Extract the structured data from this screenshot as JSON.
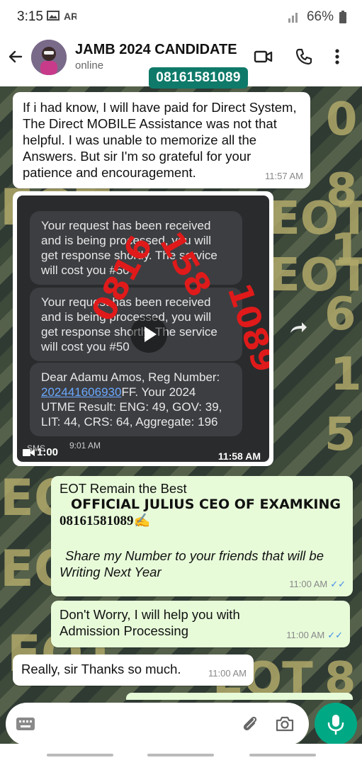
{
  "status_bar": {
    "time": "3:15",
    "battery": "66%"
  },
  "header": {
    "contact_name": "JAMB 2024 CANDIDATE",
    "status": "online"
  },
  "overlay_number": "08161581089",
  "messages": [
    {
      "text": "If i had know, I will have paid for Direct System, The Direct MOBILE Assistance was not that helpful. I was unable to memorize all the Answers. But sir I'm so grateful for your patience and encouragement.",
      "time": "11:57 AM"
    },
    {
      "video": {
        "sms_1": "Your request has been received and is being processed, you will get response shortly. The service will cost you #50",
        "sms_2": "Your request has been received and is being processed, you will get response shortly. The service will cost you #50",
        "sms_3_prefix": "Dear Adamu Amos, Reg Number: ",
        "sms_3_link": "202441606930",
        "sms_3_suffix": "FF. Your 2024 UTME Result: ENG: 49, GOV: 39, LIT: 44, CRS: 64, Aggregate: 196",
        "sms_label": "SMS",
        "sms_time": "9:01 AM",
        "duration": "1:00",
        "time": "11:58 AM",
        "red_watermark": "08161581089"
      }
    },
    {
      "line1": "EOT  Remain the Best",
      "line2": "OFFICIAL JULIUS CEO OF EXAMKING",
      "line3": "08161581089✍️",
      "line4": "Share my Number to your friends that will be Writing Next Year",
      "time": "11:00 AM"
    },
    {
      "text": "Don't Worry, I will help you with Admission Processing",
      "time": "11:00 AM"
    },
    {
      "text": "Really, sir Thanks so much.",
      "time": "11:00 AM"
    }
  ],
  "background_watermarks": [
    "EOT",
    "0",
    "8",
    "1",
    "6",
    "1",
    "5",
    "8"
  ],
  "colors": {
    "accent": "#00a884",
    "outgoing_bubble": "#e7fbd9",
    "incoming_bubble": "#ffffff",
    "read_tick": "#3f8de8"
  }
}
